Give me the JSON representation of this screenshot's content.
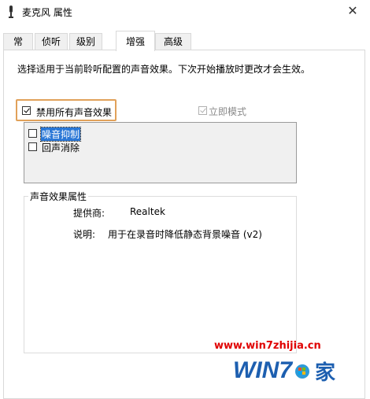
{
  "window": {
    "title": "麦克风 属性",
    "close_glyph": "✕"
  },
  "tabs": [
    {
      "label": "常规",
      "active": false
    },
    {
      "label": "侦听",
      "active": false
    },
    {
      "label": "级别",
      "active": false
    },
    {
      "label": "增强",
      "active": true
    },
    {
      "label": "高级",
      "active": false
    }
  ],
  "enhancements": {
    "description": "选择适用于当前聆听配置的声音效果。下次开始播放时更改才会生效。",
    "disable_all": {
      "label": "禁用所有声音效果",
      "checked": true
    },
    "immediate_mode": {
      "label": "立即模式",
      "checked": true,
      "enabled": false
    },
    "effects": [
      {
        "label": "噪音抑制",
        "checked": false,
        "selected": true
      },
      {
        "label": "回声消除",
        "checked": false,
        "selected": false
      }
    ]
  },
  "properties": {
    "group_title": "声音效果属性",
    "provider_label": "提供商:",
    "provider_value": "Realtek",
    "desc_label": "说明:",
    "desc_value": "用于在录音时降低静态背景噪音 (v2)"
  },
  "watermark": {
    "url": "www.win7zhijia.cn",
    "logo_text": "WIN7.家"
  },
  "colors": {
    "highlight_border": "#e1a15a",
    "selection": "#2a77d6",
    "watermark_red": "#e00000"
  }
}
